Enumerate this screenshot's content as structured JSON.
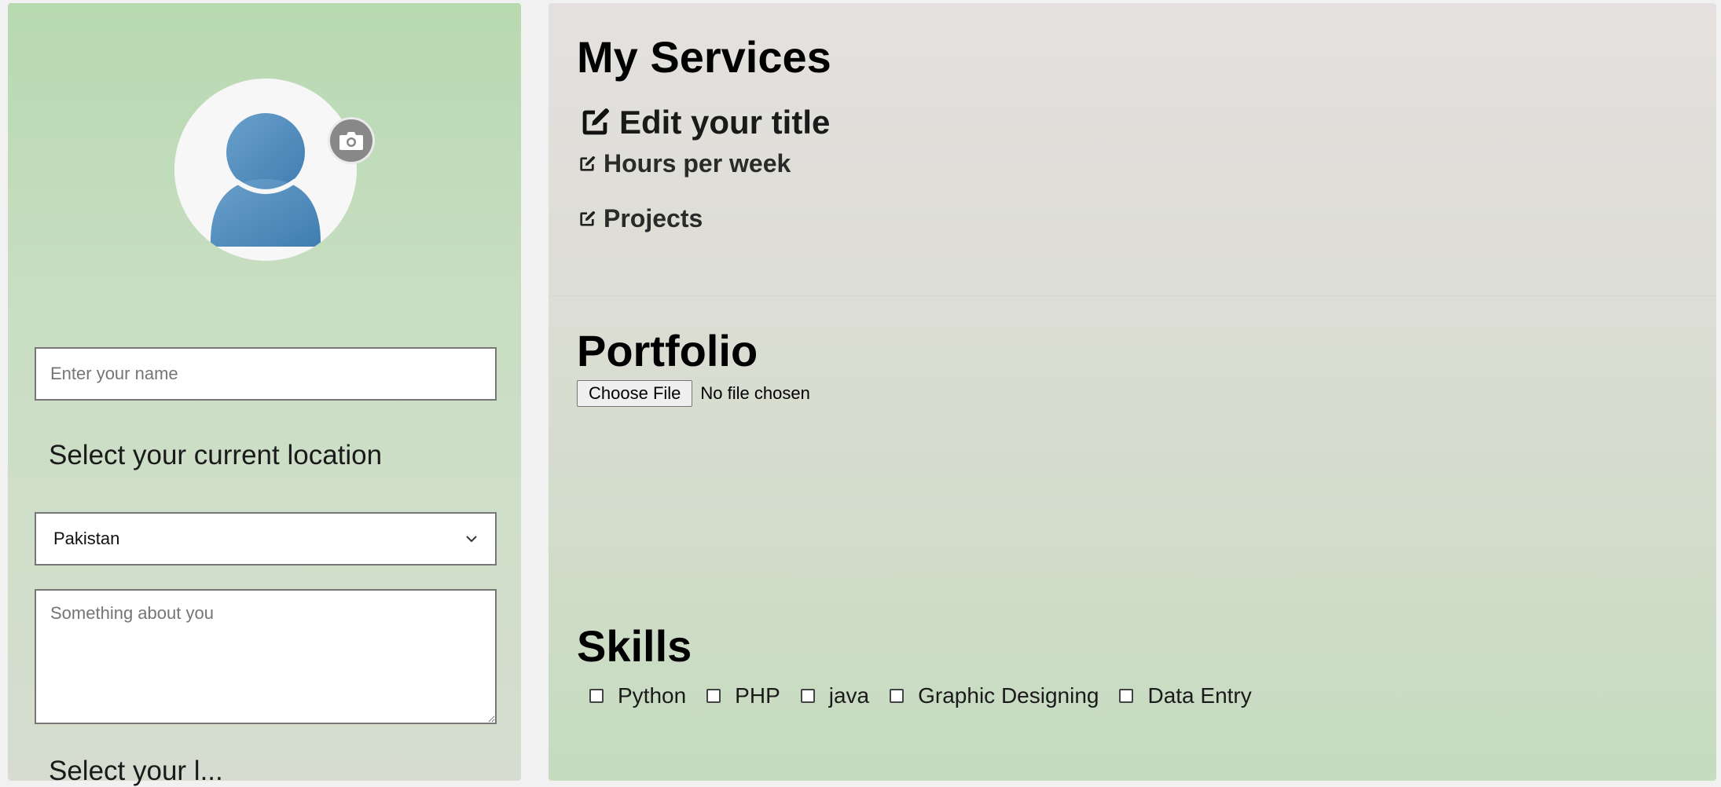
{
  "profile": {
    "name_placeholder": "Enter your name",
    "location_label": "Select your current location",
    "country_selected": "Pakistan",
    "about_placeholder": "Something about you",
    "partial_label": "Select your l..."
  },
  "services": {
    "heading": "My Services",
    "edit_title": "Edit your title",
    "hours": "Hours per week",
    "projects": "Projects"
  },
  "portfolio": {
    "heading": "Portfolio",
    "file_button": "Choose File",
    "file_status": "No file chosen"
  },
  "skills": {
    "heading": "Skills",
    "items": [
      "Python",
      "PHP",
      "java",
      "Graphic Designing",
      "Data Entry"
    ]
  },
  "icons": {
    "edit": "edit-square-icon",
    "camera": "camera-icon",
    "avatar": "user-silhouette-icon",
    "select": "chevron-down-icon"
  },
  "colors": {
    "avatar_blue": "#4a86b8",
    "left_panel_top": "#b7d9b0",
    "right_panel_top": "#e4e0df"
  }
}
